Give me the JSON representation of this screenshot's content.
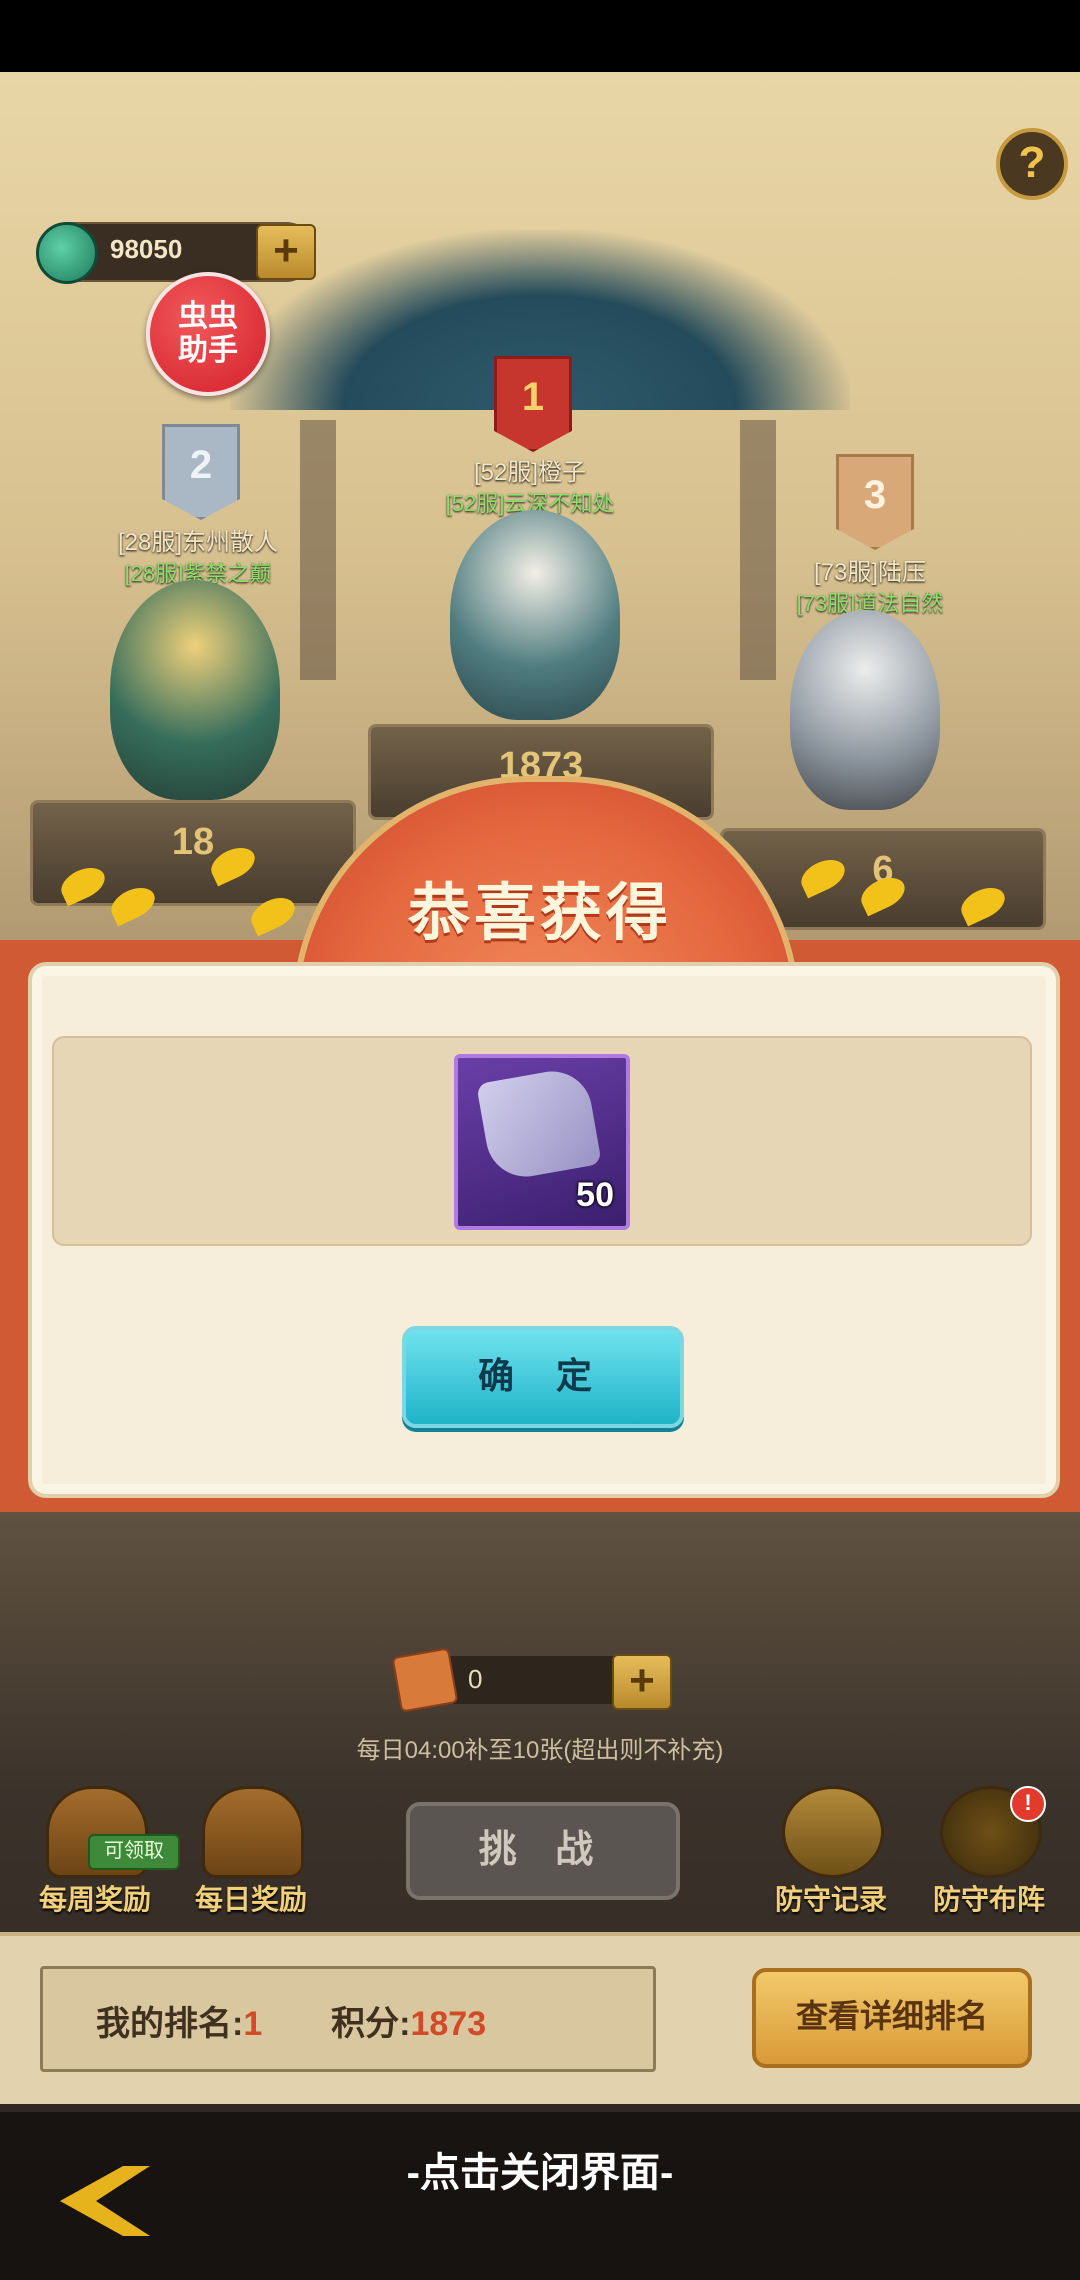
{
  "currency": {
    "amount": "98050",
    "plus": "+"
  },
  "help": {
    "label": "?"
  },
  "bug_assistant": {
    "label": "虫虫助手"
  },
  "podium": [
    {
      "rank": "2",
      "name": "[28服]东州散人",
      "guild": "[28服]紫禁之巅",
      "score": "18"
    },
    {
      "rank": "1",
      "name": "[52服]橙子",
      "guild": "[52服]云深不知处",
      "score": "1873"
    },
    {
      "rank": "3",
      "name": "[73服]陆压",
      "guild": "[73服]道法自然",
      "score": "6"
    }
  ],
  "dialog": {
    "title": "恭喜获得",
    "item": {
      "icon": "scroll-icon",
      "quantity": "50",
      "color": "#6a3fa8"
    },
    "confirm_label": "确 定"
  },
  "tickets": {
    "count": "0",
    "plus": "+",
    "refill_note": "每日04:00补至10张(超出则不补充)"
  },
  "actions": {
    "weekly_reward": "每周奖励",
    "weekly_claim_tag": "可领取",
    "daily_reward": "每日奖励",
    "challenge": "挑 战",
    "defense_log": "防守记录",
    "defense_setup": "防守布阵",
    "defense_setup_badge": "!"
  },
  "ranking": {
    "my_rank_label": "我的排名:",
    "my_rank_value": "1",
    "score_label": "积分:",
    "score_value": "1873",
    "detail_button": "查看详细排名"
  },
  "close_hint": "-点击关闭界面-",
  "colors": {
    "accent_red": "#cf5a33",
    "confirm_cyan": "#1fb3c8",
    "gold": "#f0c24e"
  }
}
